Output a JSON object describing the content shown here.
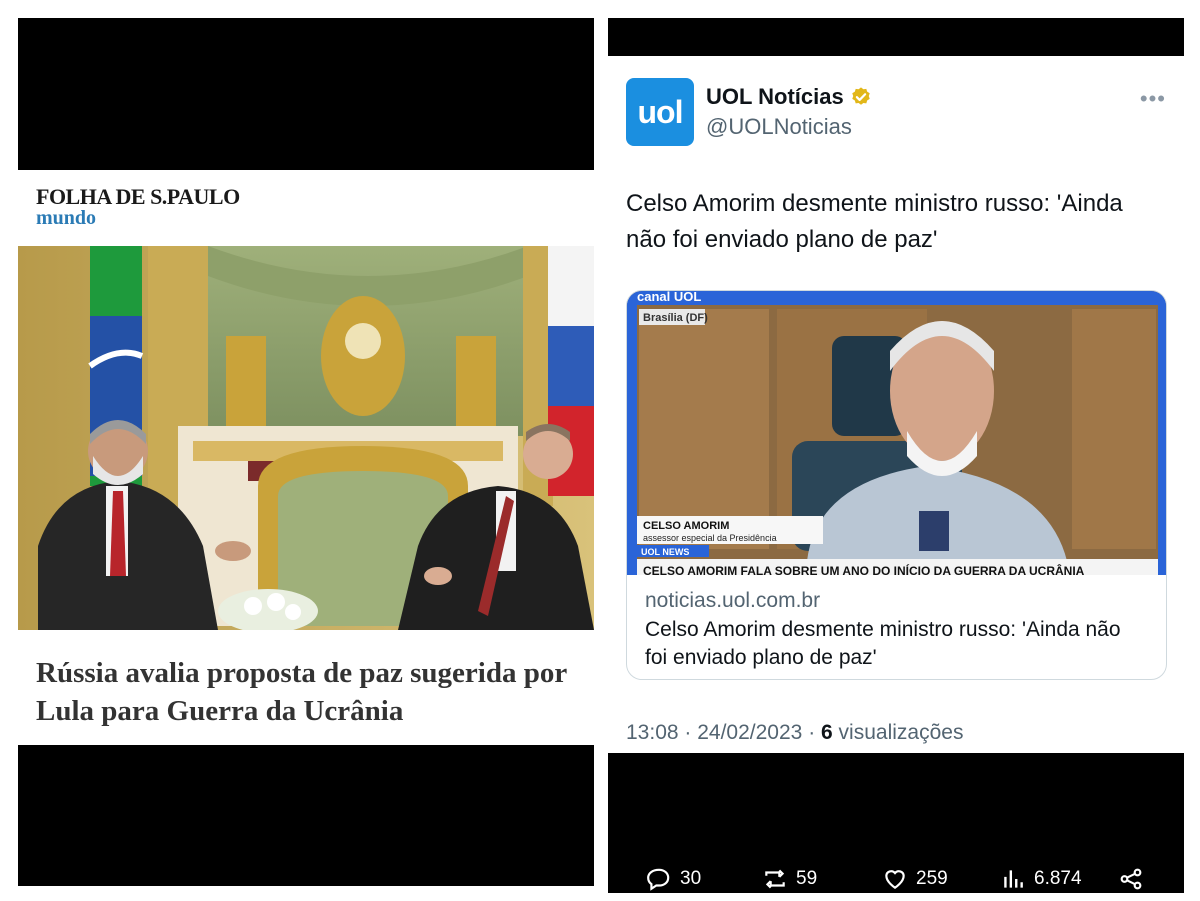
{
  "folha": {
    "logo": "FOLHA DE S.PAULO",
    "section": "mundo",
    "headline": "Rússia avalia proposta de paz sugerida por Lula para Guerra da Ucrânia"
  },
  "tweet": {
    "avatar_text": "uol",
    "display_name": "UOL Notícias",
    "handle": "@UOLNoticias",
    "more_label": "•••",
    "text": "Celso Amorim desmente ministro russo: 'Ainda não foi enviado plano de paz'",
    "card": {
      "channel_label": "canal UOL",
      "location_tag": "Brasília (DF)",
      "lower_third_name": "CELSO AMORIM",
      "lower_third_role": "assessor especial da Presidência",
      "lower_third_program": "UOL NEWS",
      "ticker": "CELSO AMORIM FALA SOBRE UM ANO DO INÍCIO DA GUERRA DA UCRÂNIA",
      "domain": "noticias.uol.com.br",
      "title": "Celso Amorim desmente ministro russo: 'Ainda não foi enviado plano de paz'"
    },
    "time": "13:08",
    "date": "24/02/2023",
    "views_count": "6",
    "views_label": "visualizações",
    "actions": {
      "replies": "30",
      "retweets": "59",
      "likes": "259",
      "views": "6.874"
    }
  },
  "colors": {
    "uol_blue": "#1b8fe0",
    "verified_gold": "#e2b719",
    "folha_section": "#2b7bb5"
  }
}
